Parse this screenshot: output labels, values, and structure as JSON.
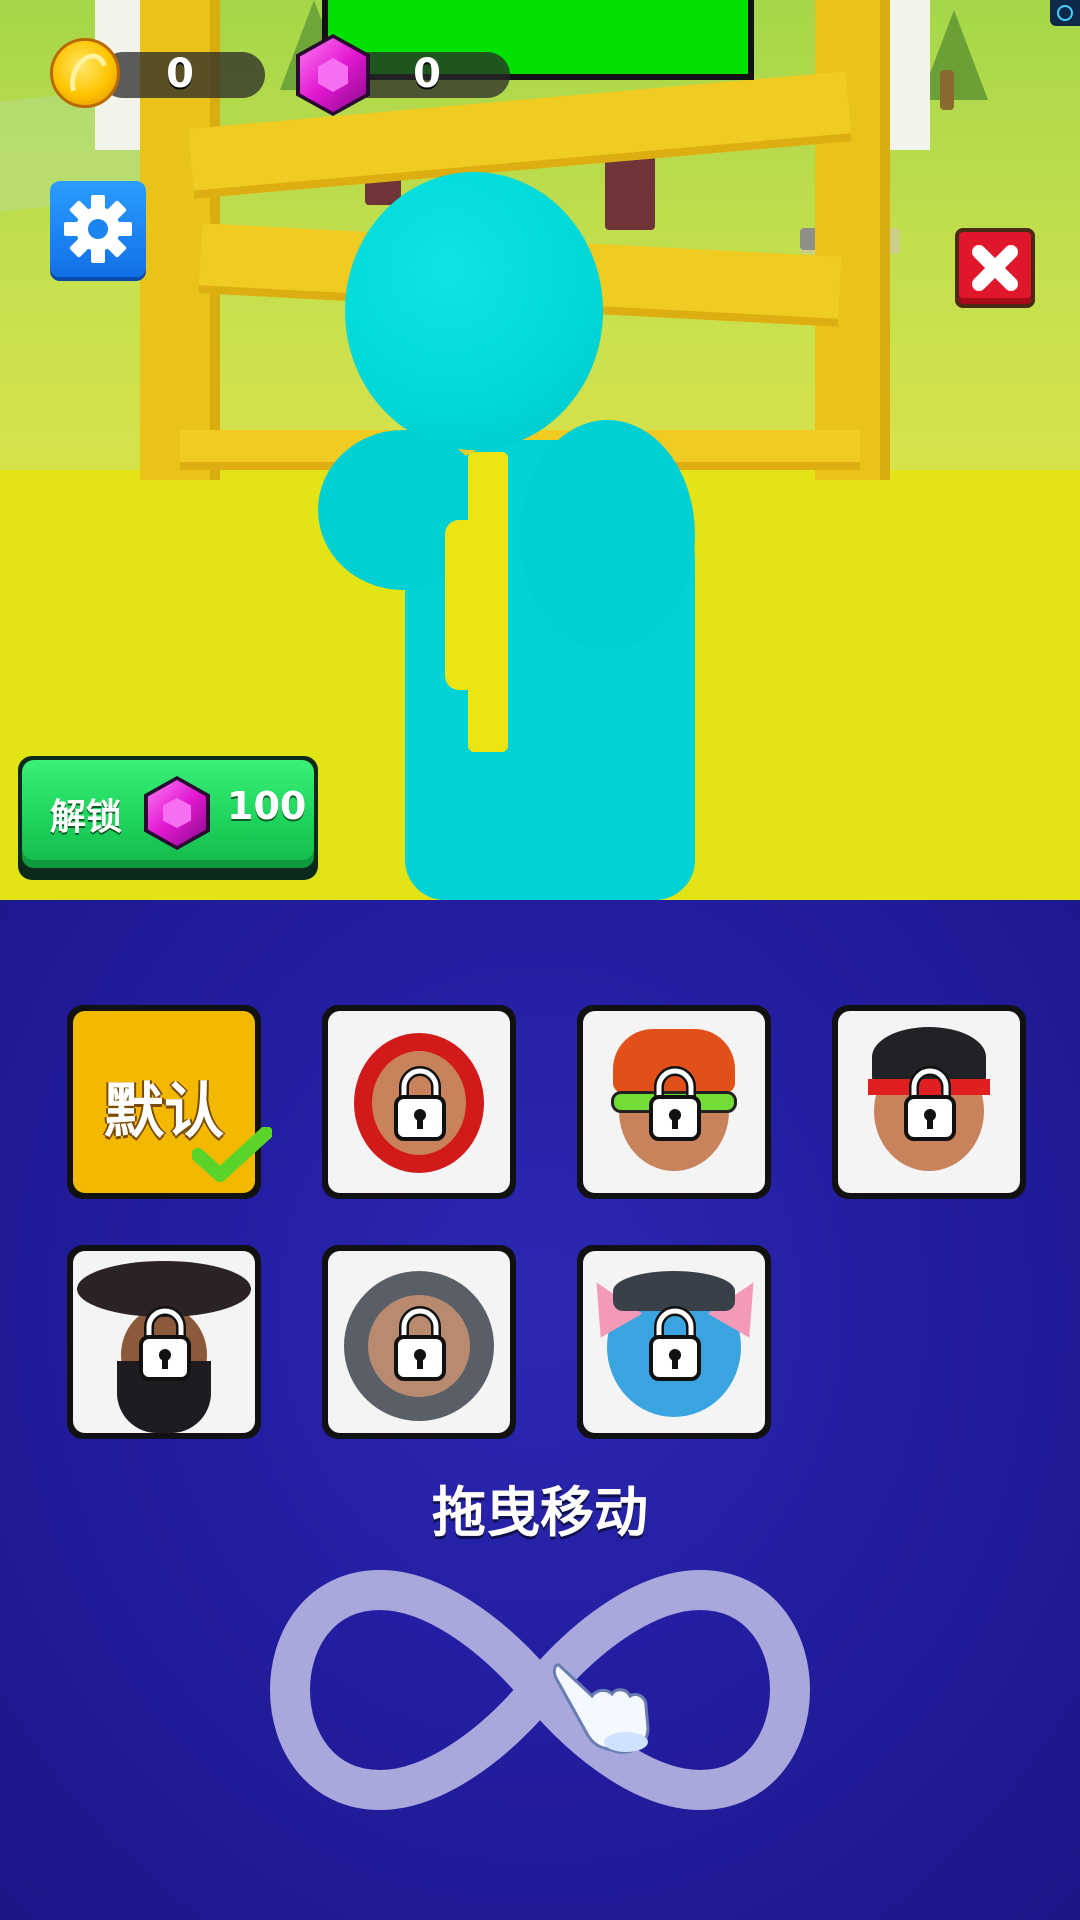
{
  "hud": {
    "coins": "0",
    "gems": "0"
  },
  "unlock": {
    "label": "解锁",
    "price": "100"
  },
  "skins": [
    {
      "id": "default",
      "label": "默认",
      "selected": true,
      "locked": false
    },
    {
      "id": "red-ninja",
      "locked": true
    },
    {
      "id": "headset",
      "locked": true
    },
    {
      "id": "bandana",
      "locked": true
    },
    {
      "id": "pirate",
      "locked": true
    },
    {
      "id": "knight",
      "locked": true
    },
    {
      "id": "blue-cat",
      "locked": true
    }
  ],
  "tutorial": {
    "text": "拖曳移动"
  },
  "colors": {
    "character": "#00dcdc",
    "panel": "#231ea0",
    "default_slot": "#f3b800",
    "unlock_button": "#1ed45c",
    "close_button": "#e0162a"
  }
}
